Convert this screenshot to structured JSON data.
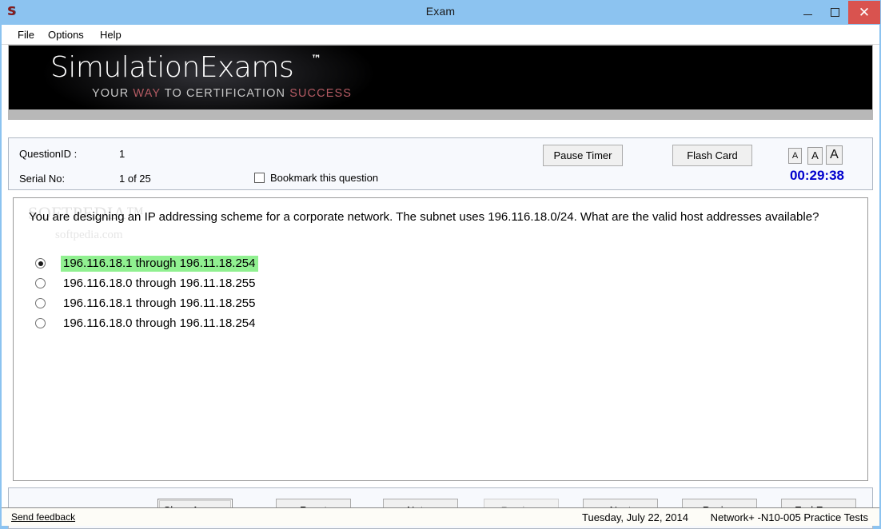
{
  "window": {
    "title": "Exam",
    "app_icon": "S",
    "minimize_label": "Minimize",
    "maximize_label": "Maximize",
    "close_label": "Close"
  },
  "menu": {
    "items": [
      {
        "label": "File"
      },
      {
        "label": "Options"
      },
      {
        "label": "Help"
      }
    ]
  },
  "banner": {
    "logo": "SimulationExams",
    "trademark": "™",
    "tagline_parts": [
      {
        "text": "YOUR ",
        "color": "grey"
      },
      {
        "text": "WAY ",
        "color": "red"
      },
      {
        "text": "TO CERTIFICATION ",
        "color": "grey"
      },
      {
        "text": "SUCCESS",
        "color": "red"
      }
    ],
    "tagline_full": "YOUR WAY TO CERTIFICATION SUCCESS"
  },
  "info": {
    "question_id_label": "QuestionID :",
    "question_id_value": "1",
    "serial_no_label": "Serial No:",
    "serial_no_value": "1 of 25",
    "bookmark_label": "Bookmark this question",
    "bookmark_checked": false,
    "pause_timer_label": "Pause Timer",
    "flash_card_label": "Flash Card",
    "font_size_small": "A",
    "font_size_medium": "A",
    "font_size_large": "A",
    "timer": "00:29:38",
    "timer_color": "#0000cd"
  },
  "question": {
    "text": "You are designing an IP addressing scheme for a corporate network. The subnet uses 196.116.18.0/24. What are the valid host addresses available?",
    "watermark": "SOFTPEDIA™",
    "watermark_sub": "softpedia.com",
    "highlight_color": "#90f090",
    "options": [
      {
        "text": "196.116.18.1 through 196.11.18.254",
        "selected": true,
        "highlighted": true
      },
      {
        "text": "196.116.18.0 through 196.11.18.255",
        "selected": false,
        "highlighted": false
      },
      {
        "text": "196.116.18.1 through 196.11.18.255",
        "selected": false,
        "highlighted": false
      },
      {
        "text": "196.116.18.0 through 196.11.18.254",
        "selected": false,
        "highlighted": false
      }
    ]
  },
  "buttons": {
    "show_answer": "Show Answer",
    "reset": "Reset",
    "notes": "Notes",
    "previous": "Previous",
    "next": "Next",
    "review": "Review",
    "end_exam": "End Exam"
  },
  "status": {
    "send_feedback": "Send feedback",
    "date": "Tuesday, July 22, 2014",
    "product": "Network+ -N10-005 Practice Tests"
  }
}
